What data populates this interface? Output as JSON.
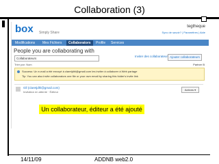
{
  "slide": {
    "title": "Collaboration (3)",
    "caption": "Un collaborateur, éditeur a été ajouté",
    "footer_date": "14/11/09",
    "footer_center": "ADDNB web2.0"
  },
  "app": {
    "logo": "box",
    "logo_sub": "Simply Share",
    "user": "tegtheque",
    "top_links": "Sync de savoir?  |  Paramètres  |  Aide",
    "tabs": [
      "Modifications",
      "Mes Fichiers",
      "Collaborators",
      "Profile",
      "Services"
    ],
    "active_tab": "Collaborators",
    "heading": "People you are collaborating with",
    "filter_value": "Collaborateurs",
    "add_link": "Inviter des collaborateurs",
    "add_button": "Ajouter collaborateurs",
    "sort_label": "Trier par: Nom",
    "folder_label": "Partner B",
    "notice_line1": "Success: Un e-mail a été envoyé à claretjdhl@gmail.com les inviter à collaborer à Web partage",
    "notice_line2": "Tip: You can also invite collaborators one file or your own email by sharing this folder's invite link",
    "collaborator_name": "Gll (claretjdhl@gmail.com)",
    "collaborator_status": "Invitation en attente · Éditeur",
    "actions_label": "Actions ▾"
  },
  "colors": {
    "accent": "#4a86c6",
    "highlight": "#ffff00",
    "notice_bg": "#fff5c8"
  }
}
